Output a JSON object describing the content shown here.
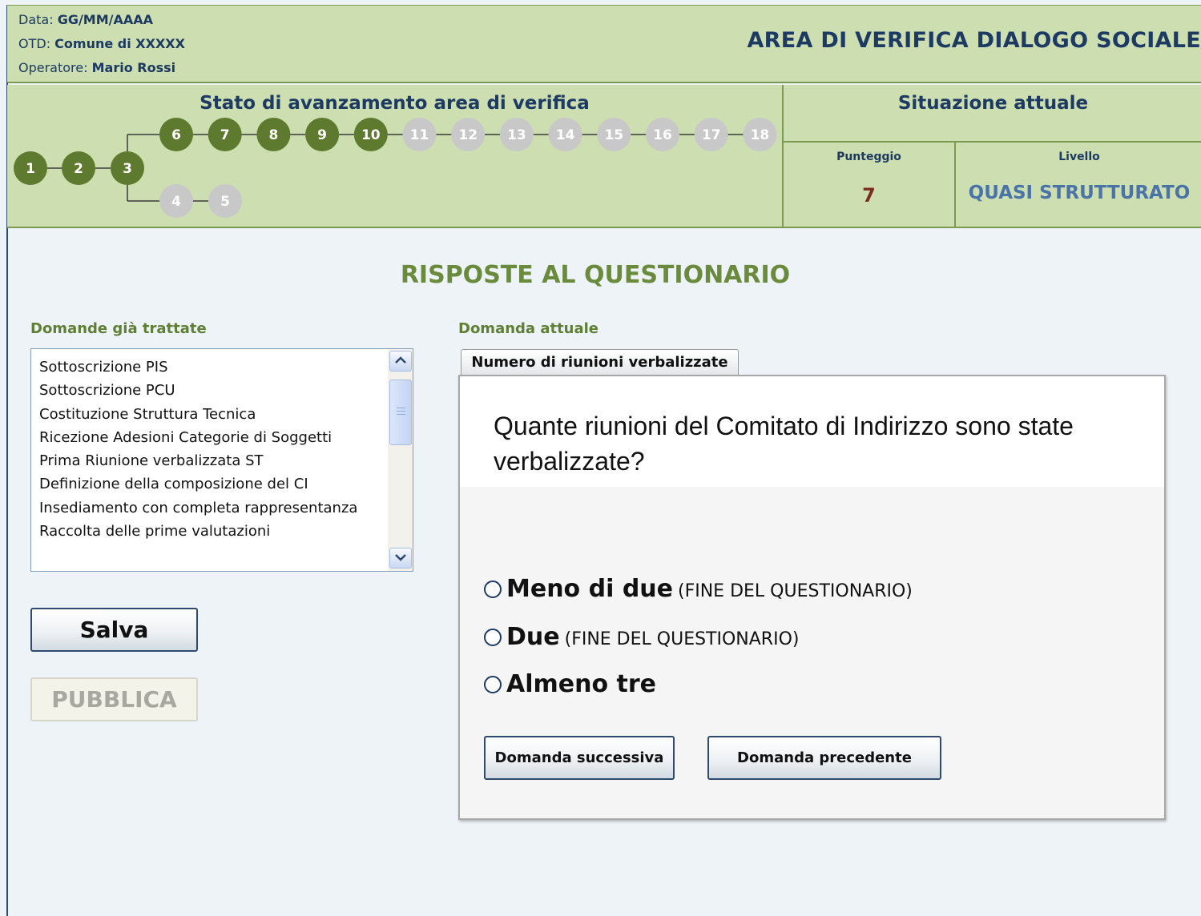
{
  "header": {
    "date_label": "Data:",
    "date_value": "GG/MM/AAAA",
    "otd_label": "OTD:",
    "otd_value": "Comune di XXXXX",
    "operator_label": "Operatore:",
    "operator_value": "Mario Rossi",
    "title": "AREA DI VERIFICA DIALOGO SOCIALE"
  },
  "progress": {
    "title": "Stato di avanzamento area di verifica",
    "steps": [
      {
        "label": "1",
        "completed": true
      },
      {
        "label": "2",
        "completed": true
      },
      {
        "label": "3",
        "completed": true
      },
      {
        "label": "4",
        "completed": false
      },
      {
        "label": "5",
        "completed": false
      },
      {
        "label": "6",
        "completed": true
      },
      {
        "label": "7",
        "completed": true
      },
      {
        "label": "8",
        "completed": true
      },
      {
        "label": "9",
        "completed": true
      },
      {
        "label": "10",
        "completed": true
      },
      {
        "label": "11",
        "completed": false
      },
      {
        "label": "12",
        "completed": false
      },
      {
        "label": "13",
        "completed": false
      },
      {
        "label": "14",
        "completed": false
      },
      {
        "label": "15",
        "completed": false
      },
      {
        "label": "16",
        "completed": false
      },
      {
        "label": "17",
        "completed": false
      },
      {
        "label": "18",
        "completed": false
      }
    ],
    "colors": {
      "completed": "#5d7a2e",
      "pending": "#c8c8c8",
      "line": "#3a3a3a"
    }
  },
  "status": {
    "title": "Situazione attuale",
    "score_label": "Punteggio",
    "score_value": "7",
    "level_label": "Livello",
    "level_value": "QUASI STRUTTURATO"
  },
  "main": {
    "section_title": "RISPOSTE AL QUESTIONARIO",
    "treated_label": "Domande già trattate",
    "current_label": "Domanda attuale",
    "treated_items": [
      "Sottoscrizione PIS",
      "Sottoscrizione PCU",
      "Costituzione Struttura Tecnica",
      "Ricezione Adesioni Categorie di Soggetti",
      "Prima Riunione verbalizzata ST",
      "Definizione della composizione del CI",
      "Insediamento con completa rappresentanza",
      "Raccolta delle prime valutazioni"
    ],
    "save_label": "Salva",
    "publish_label": "PUBBLICA"
  },
  "question": {
    "tab_label": "Numero di riunioni verbalizzate",
    "text": "Quante riunioni del Comitato di Indirizzo sono state verbalizzate?",
    "options": [
      {
        "label": "Meno di due",
        "note": "(FINE DEL QUESTIONARIO)"
      },
      {
        "label": "Due",
        "note": "(FINE DEL QUESTIONARIO)"
      },
      {
        "label": "Almeno tre",
        "note": ""
      }
    ],
    "next_label": "Domanda successiva",
    "prev_label": "Domanda precedente"
  }
}
